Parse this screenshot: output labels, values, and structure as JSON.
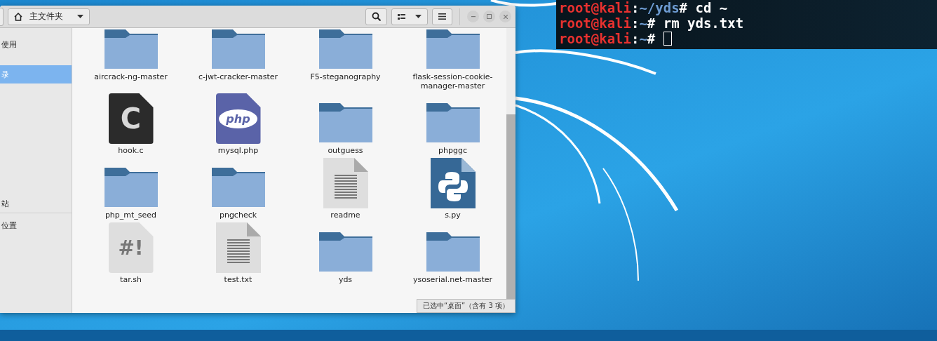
{
  "file_manager": {
    "location_button": "主文件夹",
    "sidebar": [
      {
        "label": "使用",
        "selected": false
      },
      {
        "label": "录",
        "selected": true
      },
      {
        "label": "站",
        "selected": false
      },
      {
        "label": "位置",
        "selected": false
      }
    ],
    "files": [
      {
        "name": "aircrack-ng-master",
        "kind": "folder"
      },
      {
        "name": "c-jwt-cracker-master",
        "kind": "folder"
      },
      {
        "name": "F5-steganography",
        "kind": "folder"
      },
      {
        "name": "flask-session-cookie-manager-master",
        "kind": "folder"
      },
      {
        "name": "hook.c",
        "kind": "c",
        "icon_text": "C"
      },
      {
        "name": "mysql.php",
        "kind": "php",
        "icon_text": "php"
      },
      {
        "name": "outguess",
        "kind": "folder"
      },
      {
        "name": "phpggc",
        "kind": "folder"
      },
      {
        "name": "php_mt_seed",
        "kind": "folder"
      },
      {
        "name": "pngcheck",
        "kind": "folder"
      },
      {
        "name": "readme",
        "kind": "text"
      },
      {
        "name": "s.py",
        "kind": "python"
      },
      {
        "name": "tar.sh",
        "kind": "script",
        "icon_text": "#!"
      },
      {
        "name": "test.txt",
        "kind": "text"
      },
      {
        "name": "yds",
        "kind": "folder"
      },
      {
        "name": "ysoserial.net-master",
        "kind": "folder"
      }
    ],
    "status": "已选中“桌面”（含有 3 项）"
  },
  "terminal": {
    "lines": [
      {
        "segments": [
          {
            "text": "root@kali",
            "color": "#e8312f"
          },
          {
            "text": ":",
            "color": "#ffffff"
          },
          {
            "text": "~/yds",
            "color": "#6d9bd1"
          },
          {
            "text": "# cd ~",
            "color": "#ffffff"
          }
        ]
      },
      {
        "segments": [
          {
            "text": "root@kali",
            "color": "#e8312f"
          },
          {
            "text": ":",
            "color": "#ffffff"
          },
          {
            "text": "~",
            "color": "#6d9bd1"
          },
          {
            "text": "# rm yds.txt",
            "color": "#ffffff"
          }
        ]
      },
      {
        "cursor": true,
        "segments": [
          {
            "text": "root@kali",
            "color": "#e8312f"
          },
          {
            "text": ":",
            "color": "#ffffff"
          },
          {
            "text": "~",
            "color": "#6d9bd1"
          },
          {
            "text": "# ",
            "color": "#ffffff"
          }
        ]
      }
    ]
  }
}
